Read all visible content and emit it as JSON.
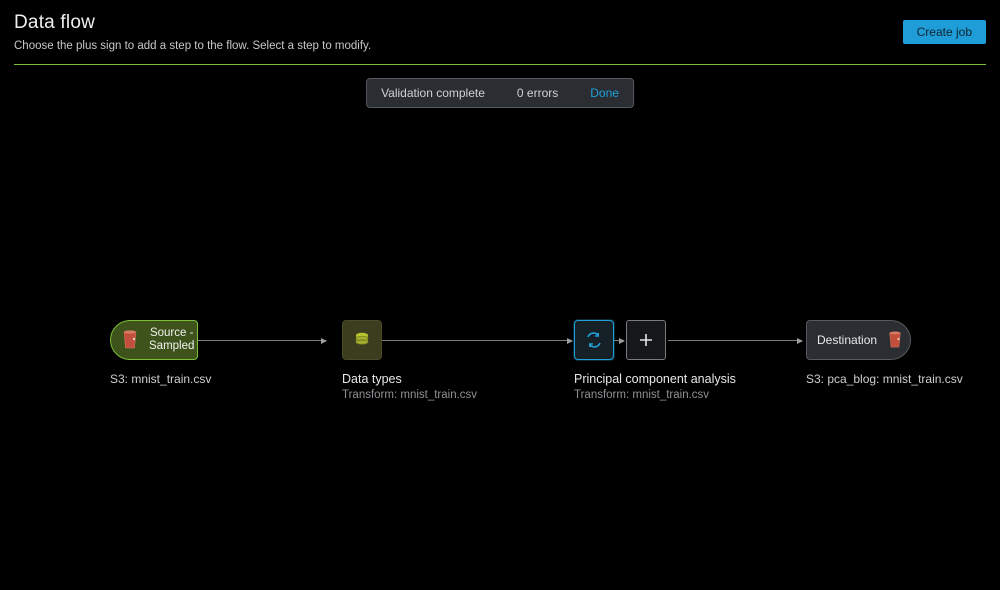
{
  "header": {
    "title": "Data flow",
    "subtitle": "Choose the plus sign to add a step to the flow. Select a step to modify.",
    "create_job_label": "Create job"
  },
  "status": {
    "message": "Validation complete",
    "errors": "0 errors",
    "done_label": "Done"
  },
  "nodes": {
    "source": {
      "label_line1": "Source -",
      "label_line2": "Sampled",
      "caption": "S3: mnist_train.csv"
    },
    "datatypes": {
      "title": "Data types",
      "subtitle": "Transform: mnist_train.csv"
    },
    "pca": {
      "title": "Principal component analysis",
      "subtitle": "Transform: mnist_train.csv"
    },
    "destination": {
      "label": "Destination",
      "caption": "S3: pca_blog: mnist_train.csv"
    }
  }
}
